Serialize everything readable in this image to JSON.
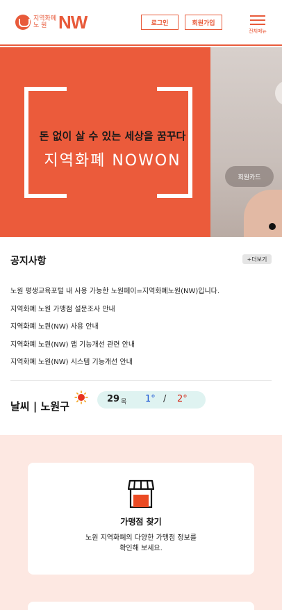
{
  "header": {
    "logo_text": "지역화폐 노 원",
    "logo_nw": "NW",
    "login_label": "로그인",
    "join_label": "회원가입",
    "menu_label": "전체메뉴"
  },
  "banner": {
    "headline": "돈 없이 살 수 있는 세상을 꿈꾸다",
    "title": "지역화폐 NOWON",
    "side_chip_label": "회원카드"
  },
  "notice": {
    "title": "공지사항",
    "more_label": "+더보기",
    "items": [
      "노원 평생교육포털 내 사용 가능한 노원페이=지역화폐노원(NW)입니다.",
      "지역화폐 노원 가맹점 설문조사 안내",
      "지역화폐 노원(NW) 사용 안내",
      "지역화폐 노원(NW) 앱 기능개선 관련 안내",
      "지역화폐 노원(NW) 시스템 기능개선 안내"
    ]
  },
  "weather": {
    "title": "날씨 | 노원구",
    "icon": "sun-icon",
    "day": "29",
    "day_of_week": "목",
    "low": "1°",
    "separator": "/",
    "high": "2°",
    "colors": {
      "low": "#1a55d4",
      "high": "#d42a1a",
      "pill": "#dff3f1"
    }
  },
  "services": {
    "card_title": "가맹점 찾기",
    "card_desc_line1": "노원 지역화폐의 다양한 가맹점 정보를",
    "card_desc_line2": "확인해 보세요.",
    "icon": "store-icon"
  },
  "colors": {
    "accent": "#e85a3a",
    "section_bg": "#fde8e2"
  }
}
